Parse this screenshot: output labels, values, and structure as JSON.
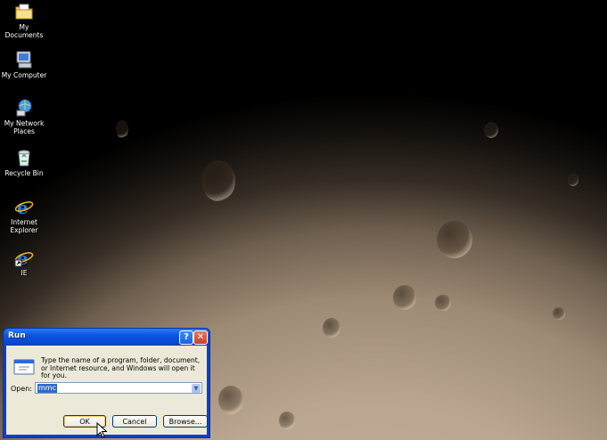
{
  "desktop": {
    "icons": [
      {
        "label_lines": [
          "My Documents"
        ],
        "icon": "folder-documents-icon"
      },
      {
        "label_lines": [
          "My Computer"
        ],
        "icon": "computer-icon"
      },
      {
        "label_lines": [
          "My Network",
          "Places"
        ],
        "icon": "network-places-icon"
      },
      {
        "label_lines": [
          "Recycle Bin"
        ],
        "icon": "recycle-bin-icon"
      },
      {
        "label_lines": [
          "Internet",
          "Explorer"
        ],
        "icon": "internet-explorer-icon"
      },
      {
        "label_lines": [
          "IE"
        ],
        "icon": "ie-shortcut-icon"
      }
    ]
  },
  "run_dialog": {
    "title": "Run",
    "help_glyph": "?",
    "close_glyph": "✕",
    "description": "Type the name of a program, folder, document, or Internet resource, and Windows will open it for you.",
    "open_label": "Open:",
    "open_value": "mmc",
    "ok_label": "OK",
    "cancel_label": "Cancel",
    "browse_label": "Browse..."
  },
  "colors": {
    "title_bar": "#0a55e0",
    "dialog_face": "#ece9d8",
    "selection": "#316ac5"
  }
}
